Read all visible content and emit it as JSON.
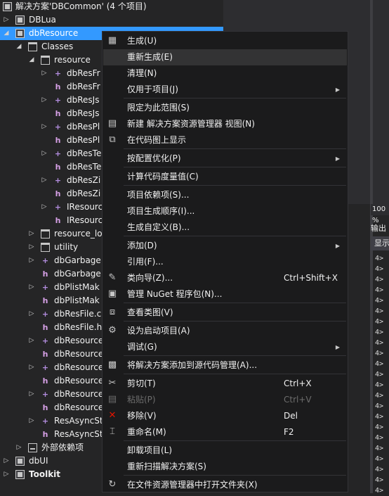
{
  "solution_explorer": {
    "rows": [
      {
        "label": "解决方案'DBCommon' (4 个项目)",
        "icon": "solution-icon",
        "arrow": ""
      },
      {
        "label": "DBLua",
        "icon": "project-icon",
        "arrow": "▷"
      },
      {
        "label": "dbResource",
        "icon": "project-icon",
        "arrow": "◢",
        "selected": true
      },
      {
        "label": "Classes",
        "icon": "folder-icon",
        "arrow": "◢"
      },
      {
        "label": "resource",
        "icon": "folder-icon",
        "arrow": "◢"
      },
      {
        "label": "dbResFr",
        "icon": "cpp-file-icon",
        "arrow": "▷"
      },
      {
        "label": "dbResFr",
        "icon": "header-file-icon",
        "arrow": ""
      },
      {
        "label": "dbResJs",
        "icon": "cpp-file-icon",
        "arrow": "▷"
      },
      {
        "label": "dbResJs",
        "icon": "header-file-icon",
        "arrow": ""
      },
      {
        "label": "dbResPl",
        "icon": "cpp-file-icon",
        "arrow": "▷"
      },
      {
        "label": "dbResPl",
        "icon": "header-file-icon",
        "arrow": ""
      },
      {
        "label": "dbResTe",
        "icon": "cpp-file-icon",
        "arrow": "▷"
      },
      {
        "label": "dbResTe",
        "icon": "header-file-icon",
        "arrow": ""
      },
      {
        "label": "dbResZi",
        "icon": "cpp-file-icon",
        "arrow": "▷"
      },
      {
        "label": "dbResZi",
        "icon": "header-file-icon",
        "arrow": ""
      },
      {
        "label": "IResourc",
        "icon": "cpp-file-icon",
        "arrow": "▷"
      },
      {
        "label": "IResourc",
        "icon": "header-file-icon",
        "arrow": ""
      },
      {
        "label": "resource_lo",
        "icon": "folder-icon",
        "arrow": "▷"
      },
      {
        "label": "utility",
        "icon": "folder-icon",
        "arrow": "▷"
      },
      {
        "label": "dbGarbage",
        "icon": "cpp-file-icon",
        "arrow": "▷"
      },
      {
        "label": "dbGarbage",
        "icon": "header-file-icon",
        "arrow": ""
      },
      {
        "label": "dbPlistMak",
        "icon": "cpp-file-icon",
        "arrow": "▷"
      },
      {
        "label": "dbPlistMak",
        "icon": "header-file-icon",
        "arrow": ""
      },
      {
        "label": "dbResFile.c",
        "icon": "cpp-file-icon",
        "arrow": "▷"
      },
      {
        "label": "dbResFile.h",
        "icon": "header-file-icon",
        "arrow": ""
      },
      {
        "label": "dbResource",
        "icon": "cpp-file-icon",
        "arrow": "▷"
      },
      {
        "label": "dbResource",
        "icon": "header-file-icon",
        "arrow": ""
      },
      {
        "label": "dbResource",
        "icon": "cpp-file-icon",
        "arrow": "▷"
      },
      {
        "label": "dbResource",
        "icon": "header-file-icon",
        "arrow": ""
      },
      {
        "label": "dbResource",
        "icon": "cpp-file-icon",
        "arrow": "▷"
      },
      {
        "label": "dbResource",
        "icon": "header-file-icon",
        "arrow": ""
      },
      {
        "label": "ResAsyncSt",
        "icon": "cpp-file-icon",
        "arrow": "▷"
      },
      {
        "label": "ResAsyncSt",
        "icon": "header-file-icon",
        "arrow": ""
      },
      {
        "label": "外部依赖项",
        "icon": "references-icon",
        "arrow": "▷"
      },
      {
        "label": "dbUI",
        "icon": "project-icon",
        "arrow": "▷"
      },
      {
        "label": "Toolkit",
        "icon": "project-icon",
        "arrow": "▷",
        "bold": true
      }
    ]
  },
  "context_menu": {
    "items": [
      {
        "type": "item",
        "label": "生成(U)",
        "icon": "build-icon",
        "glyph": "▦"
      },
      {
        "type": "item",
        "label": "重新生成(E)",
        "hover": true
      },
      {
        "type": "item",
        "label": "清理(N)"
      },
      {
        "type": "item",
        "label": "仅用于项目(J)",
        "submenu": true
      },
      {
        "type": "sep"
      },
      {
        "type": "item",
        "label": "限定为此范围(S)"
      },
      {
        "type": "item",
        "label": "新建 解决方案资源管理器 视图(N)",
        "icon": "new-view-icon",
        "glyph": "▤"
      },
      {
        "type": "item",
        "label": "在代码图上显示",
        "icon": "code-map-icon",
        "glyph": "⧉"
      },
      {
        "type": "sep"
      },
      {
        "type": "item",
        "label": "按配置优化(P)",
        "submenu": true
      },
      {
        "type": "sep"
      },
      {
        "type": "item",
        "label": "计算代码度量值(C)"
      },
      {
        "type": "sep"
      },
      {
        "type": "item",
        "label": "项目依赖项(S)..."
      },
      {
        "type": "item",
        "label": "项目生成顺序(I)..."
      },
      {
        "type": "item",
        "label": "生成自定义(B)..."
      },
      {
        "type": "sep"
      },
      {
        "type": "item",
        "label": "添加(D)",
        "submenu": true
      },
      {
        "type": "item",
        "label": "引用(F)..."
      },
      {
        "type": "item",
        "label": "类向导(Z)...",
        "shortcut": "Ctrl+Shift+X",
        "icon": "class-wizard-icon",
        "glyph": "✎"
      },
      {
        "type": "item",
        "label": "管理 NuGet 程序包(N)...",
        "icon": "nuget-icon",
        "glyph": "▣"
      },
      {
        "type": "sep"
      },
      {
        "type": "item",
        "label": "查看类图(V)",
        "icon": "class-diagram-icon",
        "glyph": "⧈"
      },
      {
        "type": "sep"
      },
      {
        "type": "item",
        "label": "设为启动项目(A)",
        "icon": "gear-icon",
        "glyph": "⚙"
      },
      {
        "type": "item",
        "label": "调试(G)",
        "submenu": true
      },
      {
        "type": "sep"
      },
      {
        "type": "item",
        "label": "将解决方案添加到源代码管理(A)...",
        "icon": "source-control-icon",
        "glyph": "▩"
      },
      {
        "type": "sep"
      },
      {
        "type": "item",
        "label": "剪切(T)",
        "shortcut": "Ctrl+X",
        "icon": "scissors-icon",
        "glyph": "✂"
      },
      {
        "type": "item",
        "label": "粘贴(P)",
        "shortcut": "Ctrl+V",
        "icon": "paste-icon",
        "glyph": "▤",
        "disabled": true
      },
      {
        "type": "item",
        "label": "移除(V)",
        "shortcut": "Del",
        "icon": "remove-icon",
        "glyph": "✕",
        "color": "#e51400"
      },
      {
        "type": "item",
        "label": "重命名(M)",
        "shortcut": "F2",
        "icon": "rename-icon",
        "glyph": "⌶"
      },
      {
        "type": "sep"
      },
      {
        "type": "item",
        "label": "卸载项目(L)"
      },
      {
        "type": "item",
        "label": "重新扫描解决方案(S)"
      },
      {
        "type": "sep"
      },
      {
        "type": "item",
        "label": "在文件资源管理器中打开文件夹(X)",
        "icon": "open-folder-icon",
        "glyph": "↻"
      }
    ]
  },
  "output_panel": {
    "zoom": "100 %",
    "title": "输出",
    "show_label": "显示",
    "lines": [
      "4>",
      "4>",
      "4>",
      "4>",
      "4>",
      "4>",
      "4>",
      "4>",
      "4>",
      "4>",
      "4>",
      "4>",
      "4>",
      "4>",
      "4>",
      "4>",
      "4>",
      "4>",
      "4>",
      "4>",
      "4>",
      "4>",
      "4>"
    ]
  }
}
